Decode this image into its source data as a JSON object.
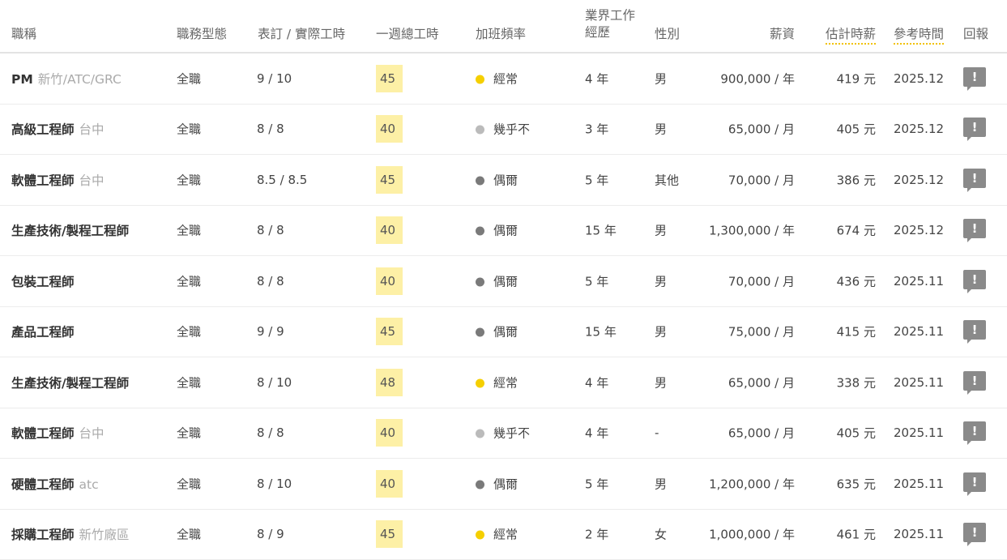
{
  "colors": {
    "often": "#f5cf00",
    "rarely": "#bbbbbb",
    "sometimes": "#7a7a7a",
    "hours_bg": "#fdf0a6"
  },
  "headers": {
    "title": "職稱",
    "job_type": "職務型態",
    "schedule": "表訂 / 實際工時",
    "weekly": "一週總工時",
    "overtime": "加班頻率",
    "exp_line1": "業界工作",
    "exp_line2": "經歷",
    "gender": "性別",
    "salary": "薪資",
    "hourly": "估計時薪",
    "ref_time": "參考時間",
    "report": "回報"
  },
  "report_icon": "exclamation-flag-icon",
  "rows": [
    {
      "title": "PM",
      "location": "新竹/ATC/GRC",
      "job_type": "全職",
      "schedule": "9 / 10",
      "weekly": "45",
      "ot_level": "often",
      "overtime": "經常",
      "experience": "4 年",
      "gender": "男",
      "salary": "900,000 / 年",
      "hourly": "419 元",
      "ref_time": "2025.12",
      "report": "!"
    },
    {
      "title": "高級工程師",
      "location": "台中",
      "job_type": "全職",
      "schedule": "8 / 8",
      "weekly": "40",
      "ot_level": "rarely",
      "overtime": "幾乎不",
      "experience": "3 年",
      "gender": "男",
      "salary": "65,000 / 月",
      "hourly": "405 元",
      "ref_time": "2025.12",
      "report": "!"
    },
    {
      "title": "軟體工程師",
      "location": "台中",
      "job_type": "全職",
      "schedule": "8.5 / 8.5",
      "weekly": "45",
      "ot_level": "sometimes",
      "overtime": "偶爾",
      "experience": "5 年",
      "gender": "其他",
      "salary": "70,000 / 月",
      "hourly": "386 元",
      "ref_time": "2025.12",
      "report": "!"
    },
    {
      "title": "生產技術/製程工程師",
      "location": "",
      "job_type": "全職",
      "schedule": "8 / 8",
      "weekly": "40",
      "ot_level": "sometimes",
      "overtime": "偶爾",
      "experience": "15 年",
      "gender": "男",
      "salary": "1,300,000 / 年",
      "hourly": "674 元",
      "ref_time": "2025.12",
      "report": "!"
    },
    {
      "title": "包裝工程師",
      "location": "",
      "job_type": "全職",
      "schedule": "8 / 8",
      "weekly": "40",
      "ot_level": "sometimes",
      "overtime": "偶爾",
      "experience": "5 年",
      "gender": "男",
      "salary": "70,000 / 月",
      "hourly": "436 元",
      "ref_time": "2025.11",
      "report": "!"
    },
    {
      "title": "產品工程師",
      "location": "",
      "job_type": "全職",
      "schedule": "9 / 9",
      "weekly": "45",
      "ot_level": "sometimes",
      "overtime": "偶爾",
      "experience": "15 年",
      "gender": "男",
      "salary": "75,000 / 月",
      "hourly": "415 元",
      "ref_time": "2025.11",
      "report": "!"
    },
    {
      "title": "生產技術/製程工程師",
      "location": "",
      "job_type": "全職",
      "schedule": "8 / 10",
      "weekly": "48",
      "ot_level": "often",
      "overtime": "經常",
      "experience": "4 年",
      "gender": "男",
      "salary": "65,000 / 月",
      "hourly": "338 元",
      "ref_time": "2025.11",
      "report": "!"
    },
    {
      "title": "軟體工程師",
      "location": "台中",
      "job_type": "全職",
      "schedule": "8 / 8",
      "weekly": "40",
      "ot_level": "rarely",
      "overtime": "幾乎不",
      "experience": "4 年",
      "gender": "-",
      "salary": "65,000 / 月",
      "hourly": "405 元",
      "ref_time": "2025.11",
      "report": "!"
    },
    {
      "title": "硬體工程師",
      "location": "atc",
      "job_type": "全職",
      "schedule": "8 / 10",
      "weekly": "40",
      "ot_level": "sometimes",
      "overtime": "偶爾",
      "experience": "5 年",
      "gender": "男",
      "salary": "1,200,000 / 年",
      "hourly": "635 元",
      "ref_time": "2025.11",
      "report": "!"
    },
    {
      "title": "採購工程師",
      "location": "新竹廠區",
      "job_type": "全職",
      "schedule": "8 / 9",
      "weekly": "45",
      "ot_level": "often",
      "overtime": "經常",
      "experience": "2 年",
      "gender": "女",
      "salary": "1,000,000 / 年",
      "hourly": "461 元",
      "ref_time": "2025.11",
      "report": "!"
    }
  ]
}
